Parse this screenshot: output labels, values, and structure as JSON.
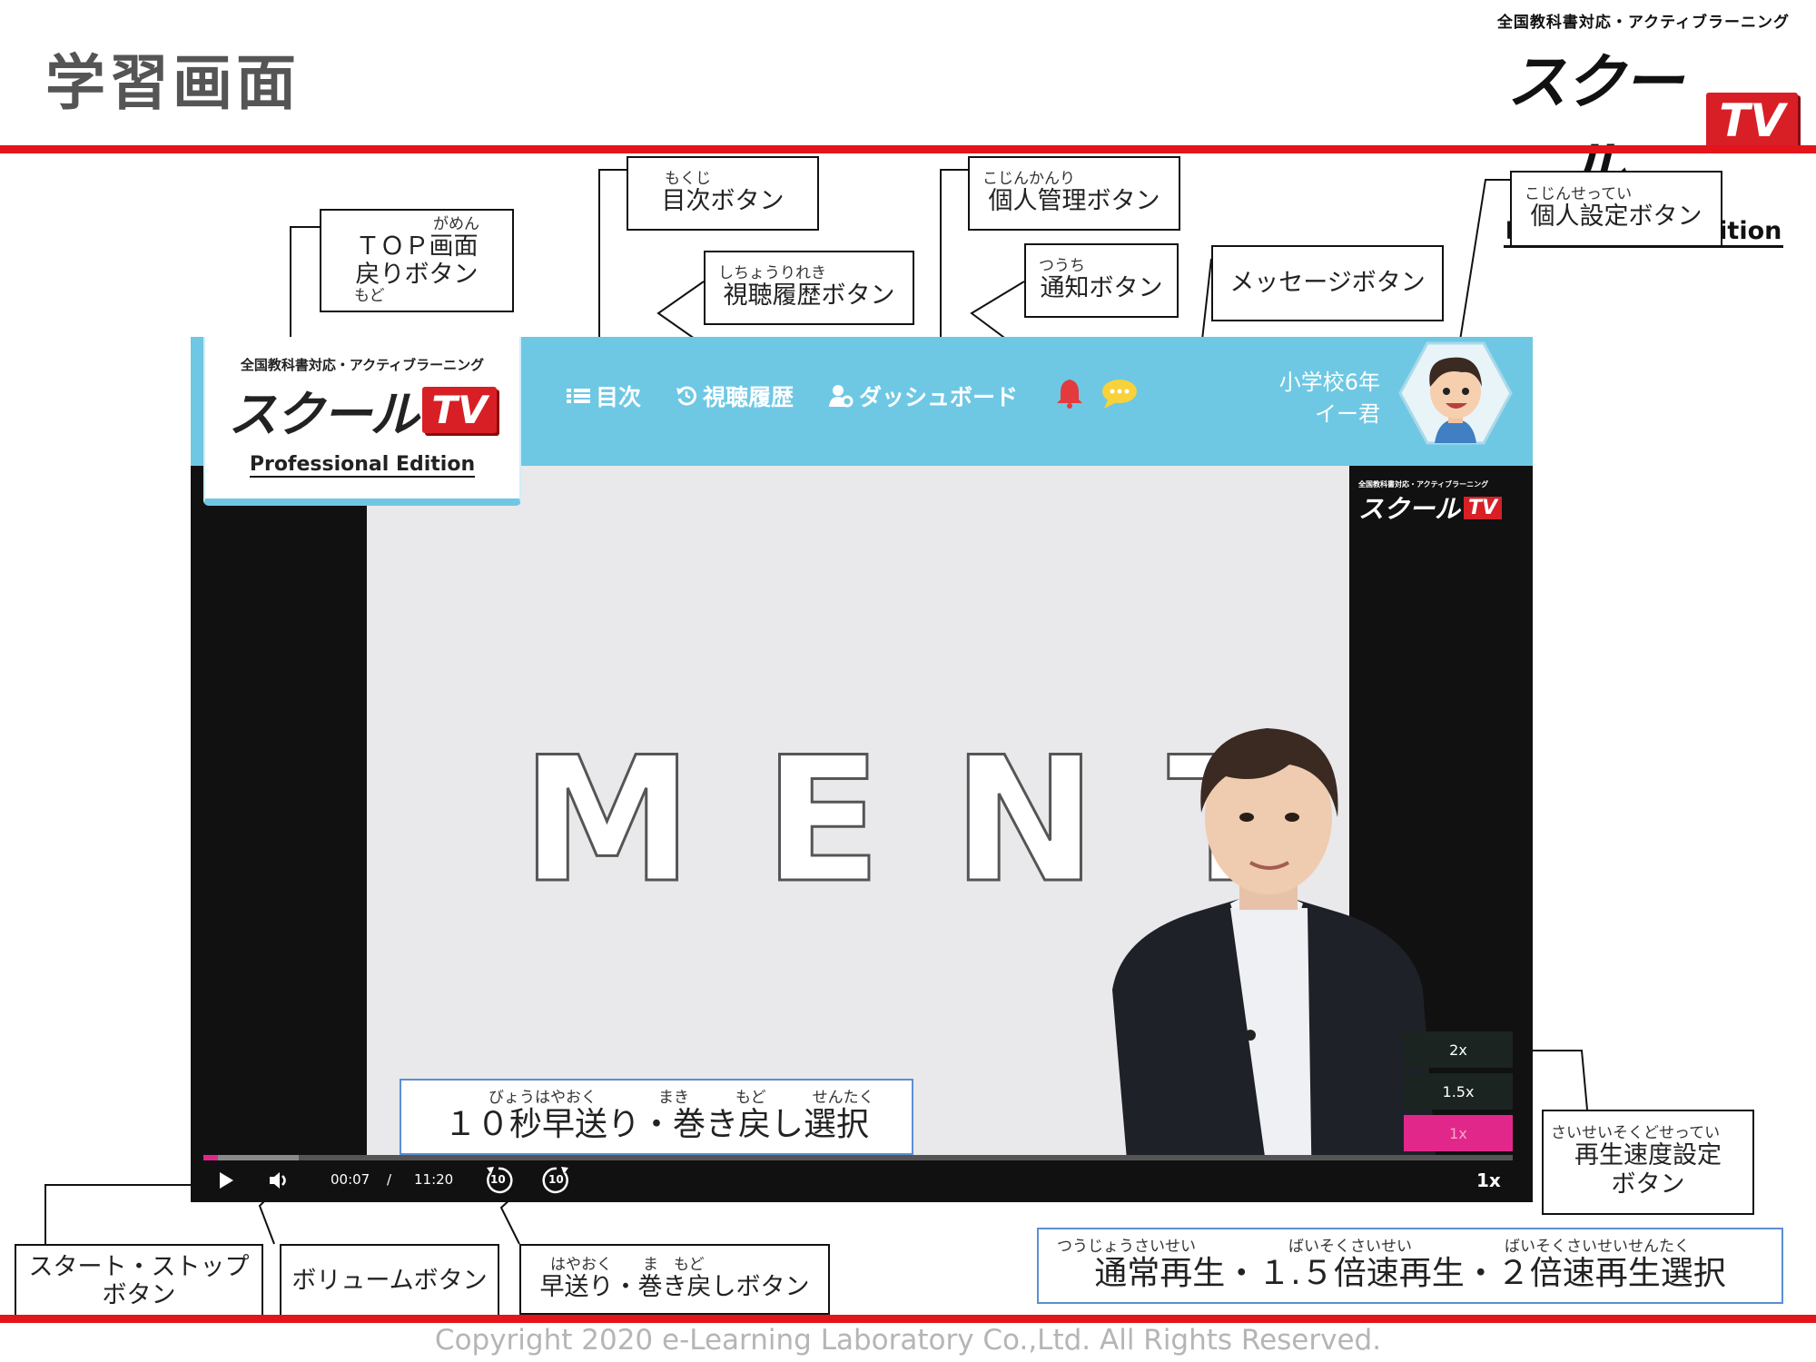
{
  "page": {
    "title": "学習画面",
    "brand": {
      "tagline": "全国教科書対応・アクティブラーニング",
      "name": "スクール",
      "tv": "TV",
      "edition": "Professional Edition"
    },
    "copyright": "Copyright 2020 e-Learning Laboratory Co.,Ltd. All Rights Reserved."
  },
  "callouts": {
    "top": {
      "ruby": "がめん",
      "line1": "ＴＯＰ画面",
      "line2": "戻りボタン",
      "ruby2": "もど"
    },
    "toc": {
      "ruby": "もくじ",
      "label": "目次ボタン"
    },
    "history": {
      "ruby": "しちょうりれき",
      "label": "視聴履歴ボタン"
    },
    "dashboard": {
      "ruby": "こじんかんり",
      "label": "個人管理ボタン"
    },
    "notify": {
      "ruby": "つうち",
      "label": "通知ボタン"
    },
    "message": {
      "label": "メッセージボタン"
    },
    "profile": {
      "ruby": "こじんせってい",
      "label": "個人設定ボタン"
    },
    "skip": {
      "ruby": "びょうはやおく　　　　まき　　　もど　　　せんたく",
      "label": "１０秒早送り・巻き戻し選択"
    },
    "speed_setting": {
      "ruby": "さいせいそくどせってい",
      "line1": "再生速度設定",
      "line2": "ボタン"
    },
    "startstop": {
      "line1": "スタート・ストップ",
      "line2": "ボタン"
    },
    "volume": {
      "label": "ボリュームボタン"
    },
    "ffrw": {
      "ruby": "はやおく　　ま　もど",
      "label": "早送り・巻き戻しボタン"
    },
    "speed_select": {
      "ruby": "つうじょうさいせい　　　　　　ばいそくさいせい　　　　　　ばいそくさいせいせんたく",
      "label": "通常再生・１.５倍速再生・２倍速再生選択"
    }
  },
  "app": {
    "logo": {
      "tagline": "全国教科書対応・アクティブラーニング",
      "name": "スクール",
      "tv": "TV",
      "edition": "Professional Edition"
    },
    "nav": {
      "toc": "目次",
      "history": "視聴履歴",
      "dashboard": "ダッシュボード"
    },
    "user": {
      "grade": "小学校6年",
      "name": "イー君"
    },
    "video": {
      "slide_text": "MENT",
      "watermark": {
        "tagline": "全国教科書対応・アクティブラーニング",
        "name": "スクール",
        "tv": "TV"
      },
      "speeds": [
        "2x",
        "1.5x",
        "1x"
      ],
      "active_speed": "1x",
      "time_current": "00:07",
      "time_sep": "/",
      "time_total": "11:20",
      "skip_seconds": "10",
      "speed_display": "1x",
      "progress_fraction": 0.011
    }
  },
  "colors": {
    "accent_red": "#e4141b",
    "nav_blue": "#6ec8e4",
    "progress_pink": "#e1288a"
  }
}
